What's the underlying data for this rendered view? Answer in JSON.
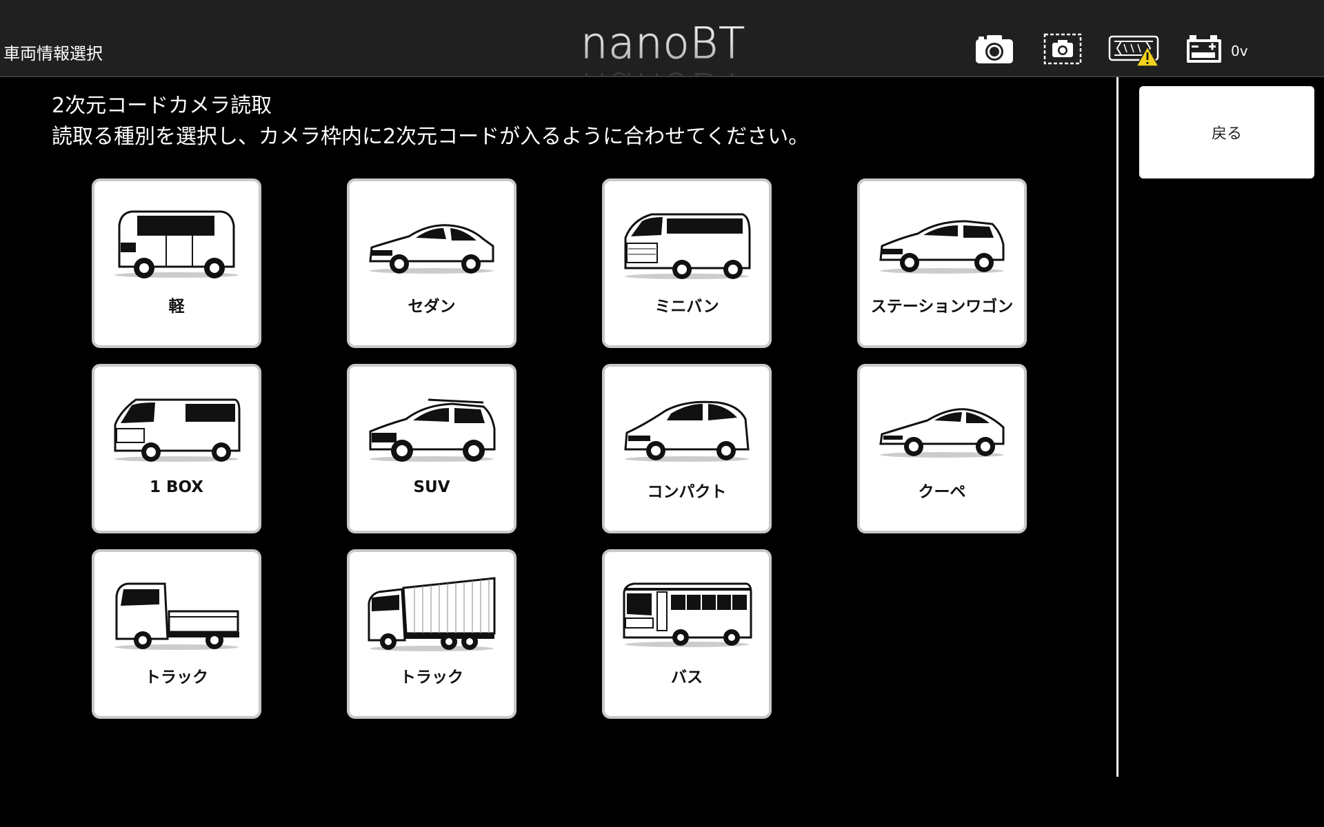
{
  "header": {
    "screen_title": "車両情報選択",
    "logo": "nanoBT",
    "voltage": "0v",
    "icons": [
      "camera-icon",
      "camera-frame-icon",
      "vehicle-warning-icon",
      "battery-icon"
    ]
  },
  "instructions": {
    "line1": "2次元コードカメラ読取",
    "line2": "読取る種別を選択し、カメラ枠内に2次元コードが入るように合わせてください。"
  },
  "back_button": {
    "label": "戻る"
  },
  "vehicle_types": [
    {
      "label": "軽",
      "icon": "kei-car-icon"
    },
    {
      "label": "セダン",
      "icon": "sedan-icon"
    },
    {
      "label": "ミニバン",
      "icon": "minivan-icon"
    },
    {
      "label": "ステーションワゴン",
      "icon": "station-wagon-icon"
    },
    {
      "label": "1 BOX",
      "icon": "one-box-van-icon"
    },
    {
      "label": "SUV",
      "icon": "suv-icon"
    },
    {
      "label": "コンパクト",
      "icon": "compact-car-icon"
    },
    {
      "label": "クーペ",
      "icon": "coupe-icon"
    },
    {
      "label": "トラック",
      "icon": "small-truck-icon"
    },
    {
      "label": "トラック",
      "icon": "large-truck-icon"
    },
    {
      "label": "バス",
      "icon": "bus-icon"
    }
  ]
}
